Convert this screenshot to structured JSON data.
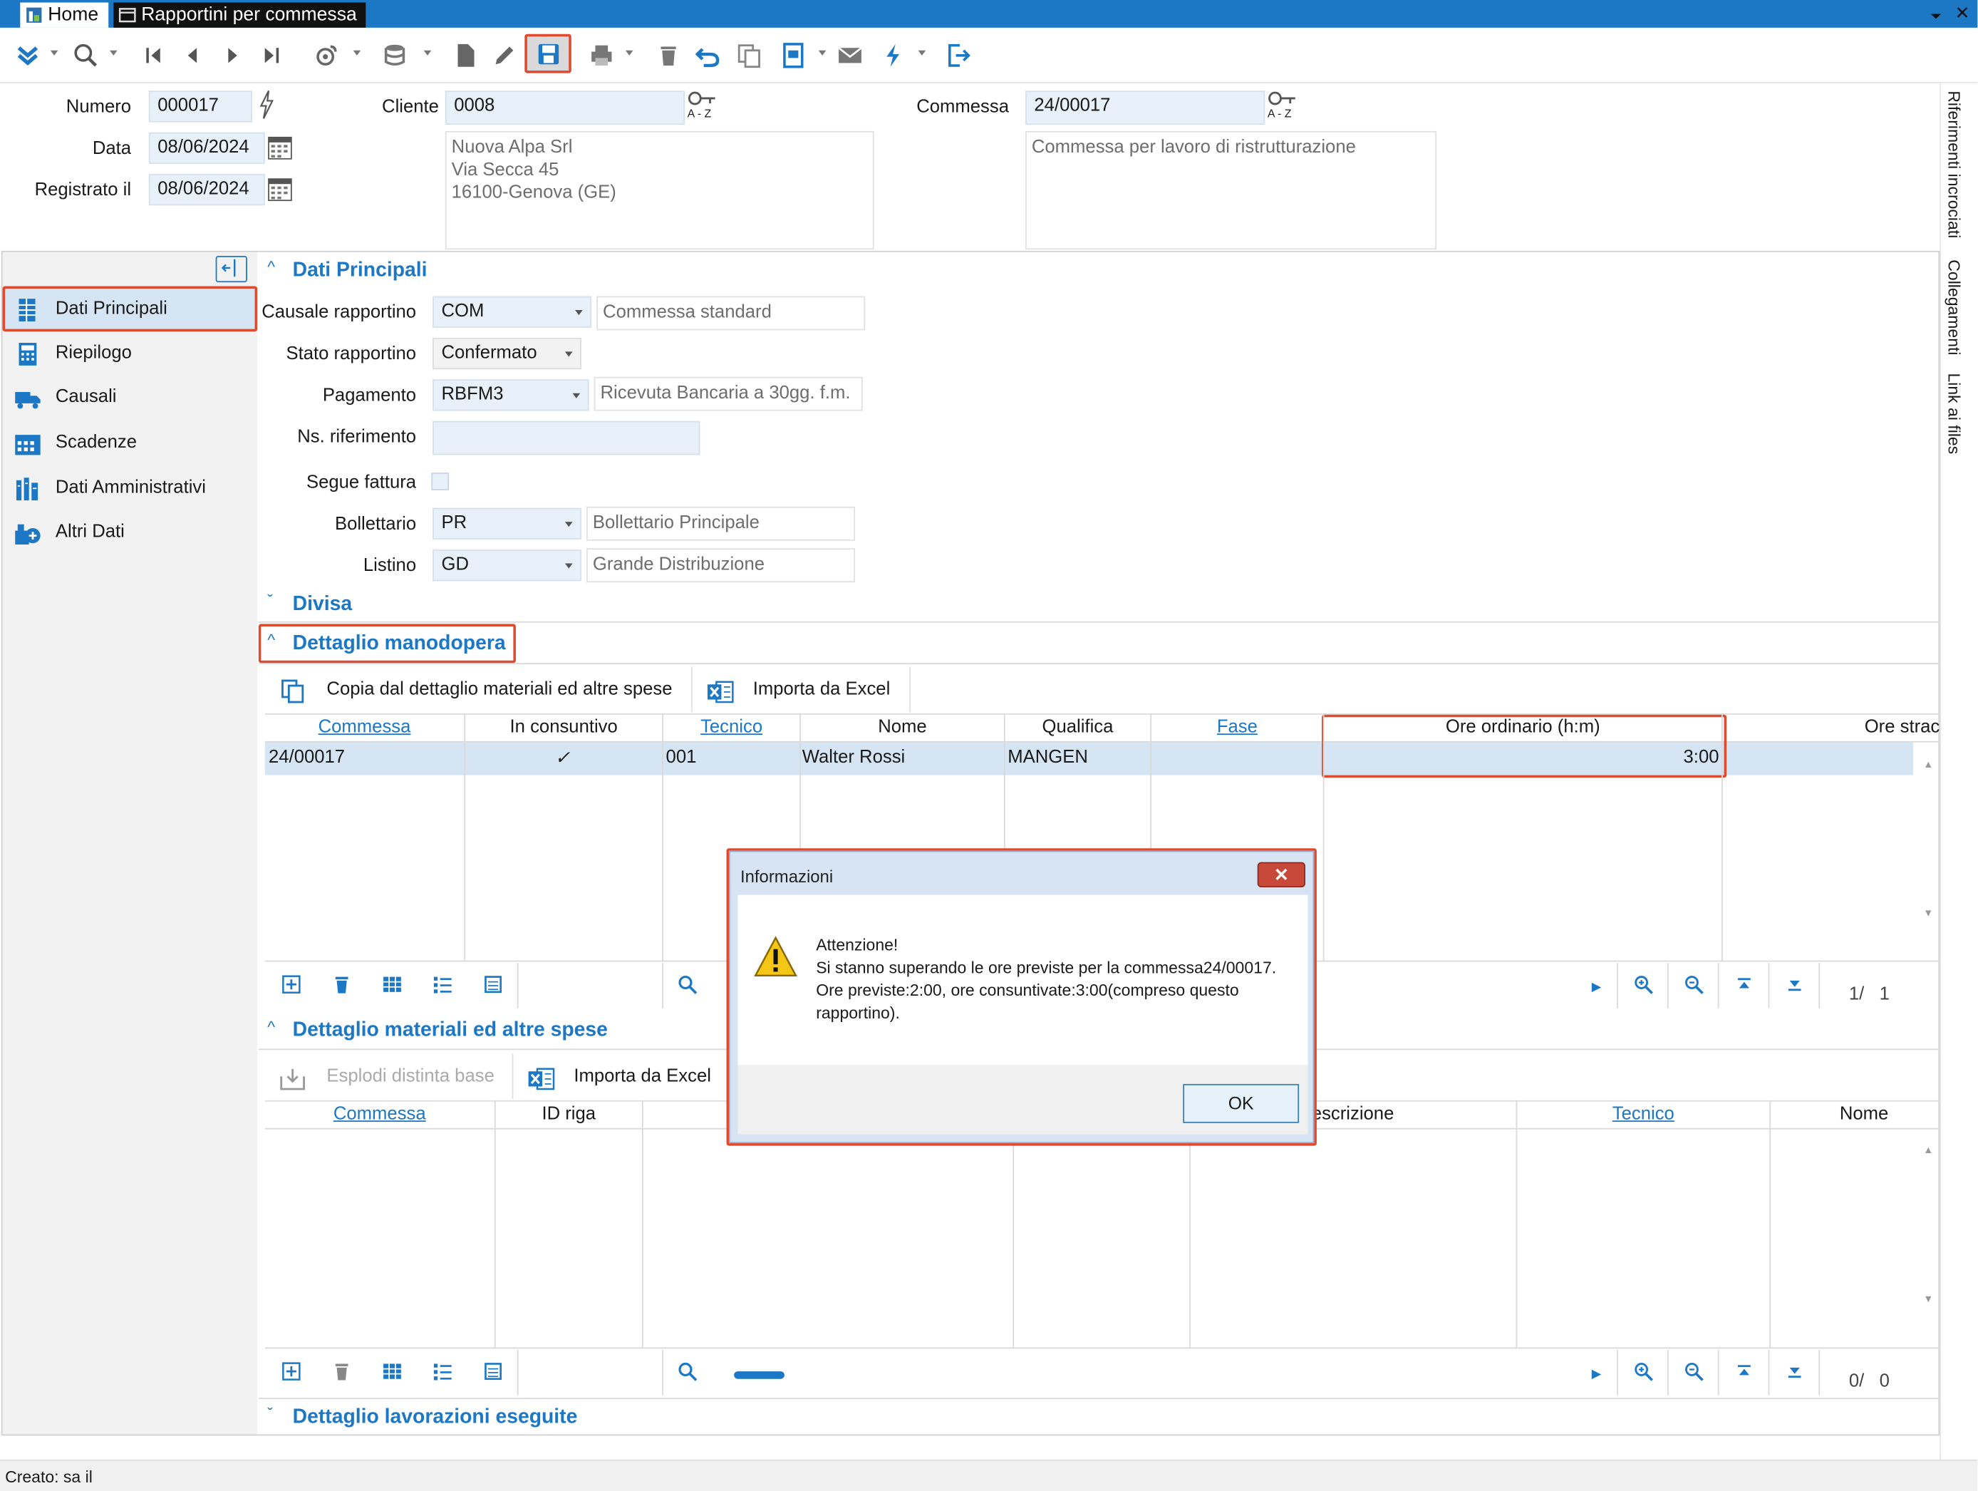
{
  "tabs": [
    {
      "label": "Home"
    },
    {
      "label": "Rapportini per commessa"
    }
  ],
  "header": {
    "numero_label": "Numero",
    "numero_value": "000017",
    "data_label": "Data",
    "data_value": "08/06/2024",
    "registrato_label": "Registrato il",
    "registrato_value": "08/06/2024",
    "cliente_label": "Cliente",
    "cliente_value": "0008",
    "cliente_address": "Nuova Alpa Srl\nVia Secca 45\n16100-Genova (GE)",
    "commessa_label": "Commessa",
    "commessa_value": "24/00017",
    "commessa_desc": "Commessa per lavoro di ristrutturazione",
    "az_label": "A - Z"
  },
  "right_tabs": [
    "Riferimenti incrociati",
    "Collegamenti",
    "Link ai files"
  ],
  "sidebar": {
    "items": [
      {
        "label": "Dati Principali",
        "icon": "table-icon"
      },
      {
        "label": "Riepilogo",
        "icon": "calculator-icon"
      },
      {
        "label": "Causali",
        "icon": "truck-icon"
      },
      {
        "label": "Scadenze",
        "icon": "calendar-icon"
      },
      {
        "label": "Dati Amministrativi",
        "icon": "books-icon"
      },
      {
        "label": "Altri Dati",
        "icon": "add-data-icon"
      }
    ]
  },
  "dati_principali": {
    "title": "Dati Principali",
    "causale_label": "Causale rapportino",
    "causale_value": "COM",
    "causale_desc": "Commessa standard",
    "stato_label": "Stato rapportino",
    "stato_value": "Confermato",
    "pagamento_label": "Pagamento",
    "pagamento_value": "RBFM3",
    "pagamento_desc": "Ricevuta Bancaria a 30gg. f.m.",
    "nsrif_label": "Ns. riferimento",
    "nsrif_value": "",
    "segue_label": "Segue fattura",
    "bollettario_label": "Bollettario",
    "bollettario_value": "PR",
    "bollettario_desc": "Bollettario Principale",
    "listino_label": "Listino",
    "listino_value": "GD",
    "listino_desc": "Grande Distribuzione"
  },
  "divisa": {
    "title": "Divisa"
  },
  "manodopera": {
    "title": "Dettaglio manodopera",
    "copy_btn": "Copia dal dettaglio materiali ed altre spese",
    "excel_btn": "Importa da Excel",
    "columns": [
      "Commessa",
      "In consuntivo",
      "Tecnico",
      "Nome",
      "Qualifica",
      "Fase",
      "Ore ordinario (h:m)",
      "Ore strac"
    ],
    "row": {
      "commessa": "24/00017",
      "consuntivo": "✓",
      "tecnico": "001",
      "nome": "Walter Rossi",
      "qualifica": "MANGEN",
      "fase": "",
      "ore": "3:00"
    },
    "pager": "1/   1"
  },
  "materiali": {
    "title": "Dettaglio materiali ed altre spese",
    "esplodi_btn": "Esplodi distinta base",
    "excel_btn": "Importa da Excel",
    "columns": [
      "Commessa",
      "ID riga",
      "escrizione",
      "Tecnico",
      "Nome"
    ],
    "pager": "0/   0"
  },
  "lavorazioni": {
    "title": "Dettaglio lavorazioni eseguite"
  },
  "status": {
    "text": "Creato: sa il"
  },
  "dialog": {
    "title": "Informazioni",
    "line1": "Attenzione!",
    "line2": "Si stanno superando le ore previste per la commessa24/00017.",
    "line3": "Ore previste:2:00, ore consuntivate:3:00(compreso questo",
    "line4": "rapportino).",
    "ok": "OK"
  },
  "colors": {
    "accent": "#1c77c4",
    "highlight": "#e04a2f",
    "field_bg": "#e8f0fa",
    "row_selected": "#d5e5f3"
  }
}
